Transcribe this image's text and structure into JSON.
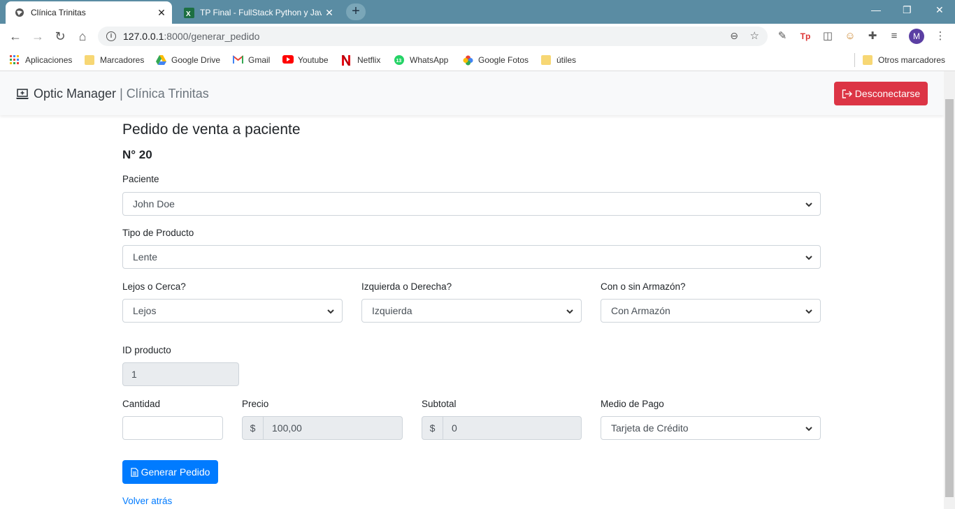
{
  "browser": {
    "tabs": [
      {
        "title": "Clínica Trinitas",
        "active": true,
        "icon": "globe-icon"
      },
      {
        "title": "TP Final - FullStack Python y Java",
        "active": false,
        "icon": "excel-icon"
      }
    ],
    "url_host": "127.0.0.1",
    "url_path": ":8000/generar_pedido",
    "profile_initial": "M",
    "bookmarks": [
      {
        "label": "Aplicaciones",
        "icon": "apps-grid-icon"
      },
      {
        "label": "Marcadores",
        "icon": "folder-icon"
      },
      {
        "label": "Google Drive",
        "icon": "drive-icon"
      },
      {
        "label": "Gmail",
        "icon": "gmail-icon"
      },
      {
        "label": "Youtube",
        "icon": "youtube-icon"
      },
      {
        "label": "Netflix",
        "icon": "netflix-icon"
      },
      {
        "label": "WhatsApp",
        "icon": "whatsapp-icon"
      },
      {
        "label": "Google Fotos",
        "icon": "photos-icon"
      },
      {
        "label": "útiles",
        "icon": "folder-icon"
      }
    ],
    "other_bookmarks": "Otros marcadores"
  },
  "navbar": {
    "brand": "Optic Manager",
    "separator": " | ",
    "subbrand": "Clínica Trinitas",
    "logout_label": "Desconectarse"
  },
  "form": {
    "title": "Pedido de venta a paciente",
    "number": "N° 20",
    "paciente_label": "Paciente",
    "paciente_value": "John Doe",
    "tipo_label": "Tipo de Producto",
    "tipo_value": "Lente",
    "lejos_label": "Lejos o Cerca?",
    "lejos_value": "Lejos",
    "lado_label": "Izquierda o Derecha?",
    "lado_value": "Izquierda",
    "armazon_label": "Con o sin Armazón?",
    "armazon_value": "Con Armazón",
    "id_label": "ID producto",
    "id_value": "1",
    "cantidad_label": "Cantidad",
    "cantidad_value": "",
    "precio_label": "Precio",
    "precio_currency": "$",
    "precio_value": "100,00",
    "subtotal_label": "Subtotal",
    "subtotal_currency": "$",
    "subtotal_value": "0",
    "pago_label": "Medio de Pago",
    "pago_value": "Tarjeta de Crédito",
    "submit_label": "Generar Pedido",
    "back_label": "Volver atrás"
  },
  "colors": {
    "primary": "#007bff",
    "danger": "#dc3545",
    "tabbar": "#5a8ca3"
  }
}
